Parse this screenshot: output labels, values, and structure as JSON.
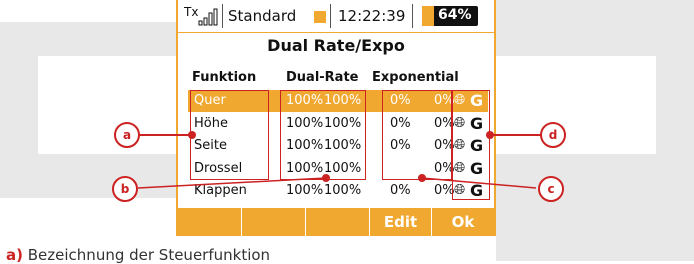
{
  "statusbar": {
    "tx_label": "Tx",
    "model_name": "Standard",
    "time": "12:22:39",
    "battery": "64%"
  },
  "screen_title": "Dual Rate/Expo",
  "columns": {
    "funktion": "Funktion",
    "dual_rate": "Dual-Rate",
    "exponential": "Exponential"
  },
  "rows": [
    {
      "name": "Quer",
      "dr1": "100%",
      "dr2": "100%",
      "ex1": "0%",
      "ex2": "0%",
      "g": "G"
    },
    {
      "name": "Höhe",
      "dr1": "100%",
      "dr2": "100%",
      "ex1": "0%",
      "ex2": "0%",
      "g": "G"
    },
    {
      "name": "Seite",
      "dr1": "100%",
      "dr2": "100%",
      "ex1": "0%",
      "ex2": "0%",
      "g": "G"
    },
    {
      "name": "Drossel",
      "dr1": "100%",
      "dr2": "100%",
      "ex1": "",
      "ex2": "0%",
      "g": "G"
    },
    {
      "name": "Klappen",
      "dr1": "100%",
      "dr2": "100%",
      "ex1": "0%",
      "ex2": "0%",
      "g": "G"
    }
  ],
  "buttons": {
    "b1": "",
    "b2": "",
    "b3": "",
    "edit": "Edit",
    "ok": "Ok"
  },
  "callouts": {
    "a": "a",
    "b": "b",
    "c": "c",
    "d": "d"
  },
  "caption": {
    "letter": "a)",
    "text": "Bezeichnung der Steuerfunktion"
  },
  "colors": {
    "accent": "#f0a830",
    "callout_red": "#cc2222"
  }
}
